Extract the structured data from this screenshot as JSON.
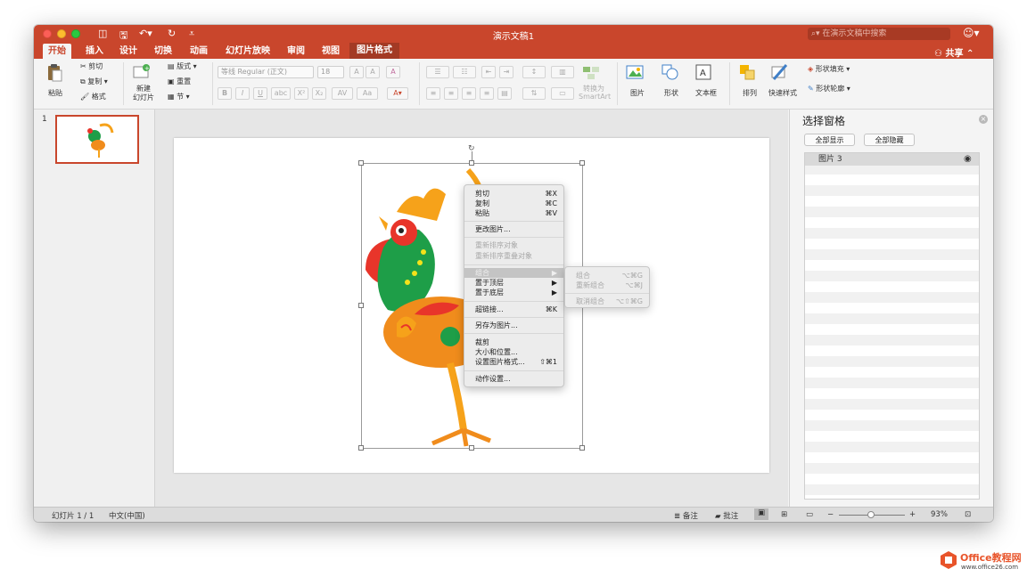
{
  "window": {
    "title": "演示文稿1",
    "search_placeholder": "在演示文稿中搜索",
    "share_label": "共享"
  },
  "tabs": [
    "开始",
    "插入",
    "设计",
    "切换",
    "动画",
    "幻灯片放映",
    "审阅",
    "视图",
    "图片格式"
  ],
  "ribbon": {
    "paste": "粘贴",
    "cut": "剪切",
    "copy": "复制",
    "format": "格式",
    "new_slide": "新建",
    "new_slide_2": "幻灯片",
    "layout": "版式",
    "reset": "重置",
    "section": "节",
    "font_name": "等线 Regular (正文)",
    "font_size": "18",
    "convert_smartart": "转换为",
    "convert_smartart_2": "SmartArt",
    "picture": "图片",
    "shapes": "形状",
    "textbox": "文本框",
    "arrange": "排列",
    "quick_styles": "快速样式",
    "shape_fill": "形状填充",
    "shape_outline": "形状轮廓"
  },
  "slides": {
    "number": "1"
  },
  "context_menu": {
    "cut": "剪切",
    "cut_sc": "⌘X",
    "copy": "复制",
    "copy_sc": "⌘C",
    "paste": "粘贴",
    "paste_sc": "⌘V",
    "change_picture": "更改图片...",
    "reorder": "重新排序对象",
    "reorder_overlap": "重新排序重叠对象",
    "group": "组合",
    "bring_front": "置于顶层",
    "send_back": "置于底层",
    "hyperlink": "超链接...",
    "hyperlink_sc": "⌘K",
    "save_as_picture": "另存为图片...",
    "crop": "裁剪",
    "size_position": "大小和位置...",
    "format_picture": "设置图片格式...",
    "format_picture_sc": "⇧⌘1",
    "action_settings": "动作设置..."
  },
  "submenu": {
    "group": "组合",
    "group_sc": "⌥⌘G",
    "regroup": "重新组合",
    "regroup_sc": "⌥⌘J",
    "ungroup": "取消组合",
    "ungroup_sc": "⌥⇧⌘G"
  },
  "selection_pane": {
    "title": "选择窗格",
    "show_all": "全部显示",
    "hide_all": "全部隐藏",
    "items": [
      "图片 3"
    ]
  },
  "status": {
    "slide_info": "幻灯片 1 / 1",
    "language": "中文(中国)",
    "notes": "备注",
    "comments": "批注",
    "zoom": "93%"
  },
  "brand": {
    "name": "Office教程网",
    "url": "www.office26.com"
  },
  "colors": {
    "accent": "#c9462c"
  }
}
